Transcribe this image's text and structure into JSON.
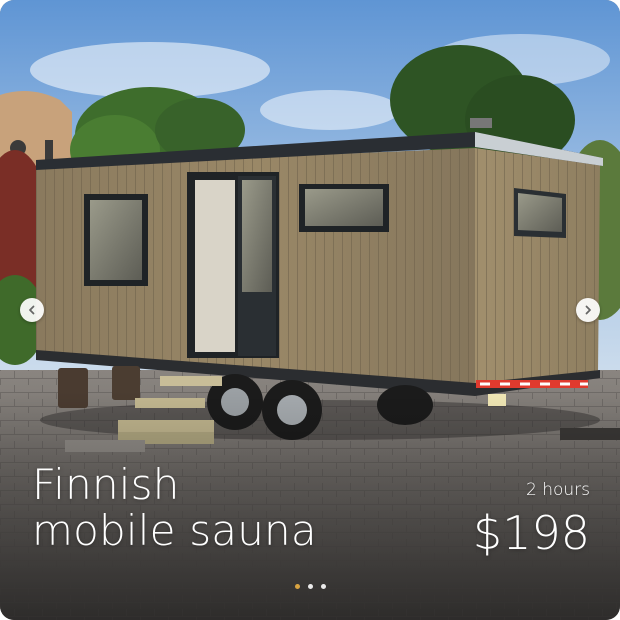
{
  "card": {
    "title_line1": "Finnish",
    "title_line2": "mobile sauna",
    "duration": "2 hours",
    "price": "$198"
  },
  "photo": {
    "subject": "wooden mobile sauna trailer"
  },
  "carousel": {
    "prev_icon": "chevron-left-icon",
    "next_icon": "chevron-right-icon",
    "total_slides": 3,
    "active_slide": 1
  },
  "colors": {
    "text": "#ffffff",
    "active_dot": "#d9a441",
    "inactive_dot": "#ffffff"
  }
}
